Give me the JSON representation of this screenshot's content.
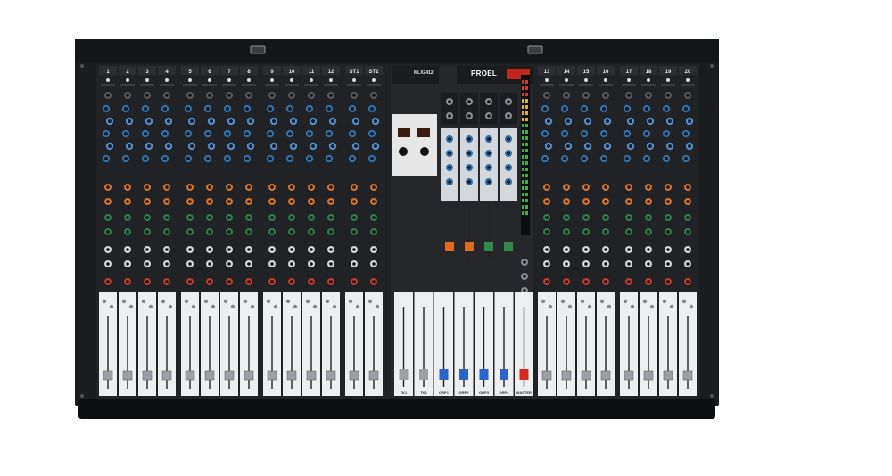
{
  "brand": {
    "logo": "PROEL",
    "model": "MLX2412"
  },
  "colors": {
    "chassis": "#1b1c1e",
    "panel": "#202225",
    "fader_panel": "#eceef0",
    "knob_blue": "#2f6fa8",
    "knob_orange": "#d4742c",
    "knob_green": "#2f7d4a",
    "knob_red": "#c0392b",
    "fader_cap_grey": "#9aa0a6",
    "fader_cap_blue": "#2a63c9",
    "fader_cap_red": "#d6281e",
    "fader_cap_orange": "#e06a22",
    "fader_cap_green": "#2f8a4a"
  },
  "left_bank": {
    "channel_numbers": [
      "1",
      "2",
      "3",
      "4",
      "5",
      "6",
      "7",
      "8",
      "9",
      "10",
      "11",
      "12",
      "ST1",
      "ST2"
    ]
  },
  "master": {
    "cap_labels": [
      "TK1",
      "TK2",
      "GRP1",
      "GRP2",
      "GRP3",
      "GRP4",
      "MASTER"
    ]
  },
  "right_bank": {
    "channel_numbers": [
      "13",
      "14",
      "15",
      "16",
      "17",
      "18",
      "19",
      "20"
    ]
  }
}
